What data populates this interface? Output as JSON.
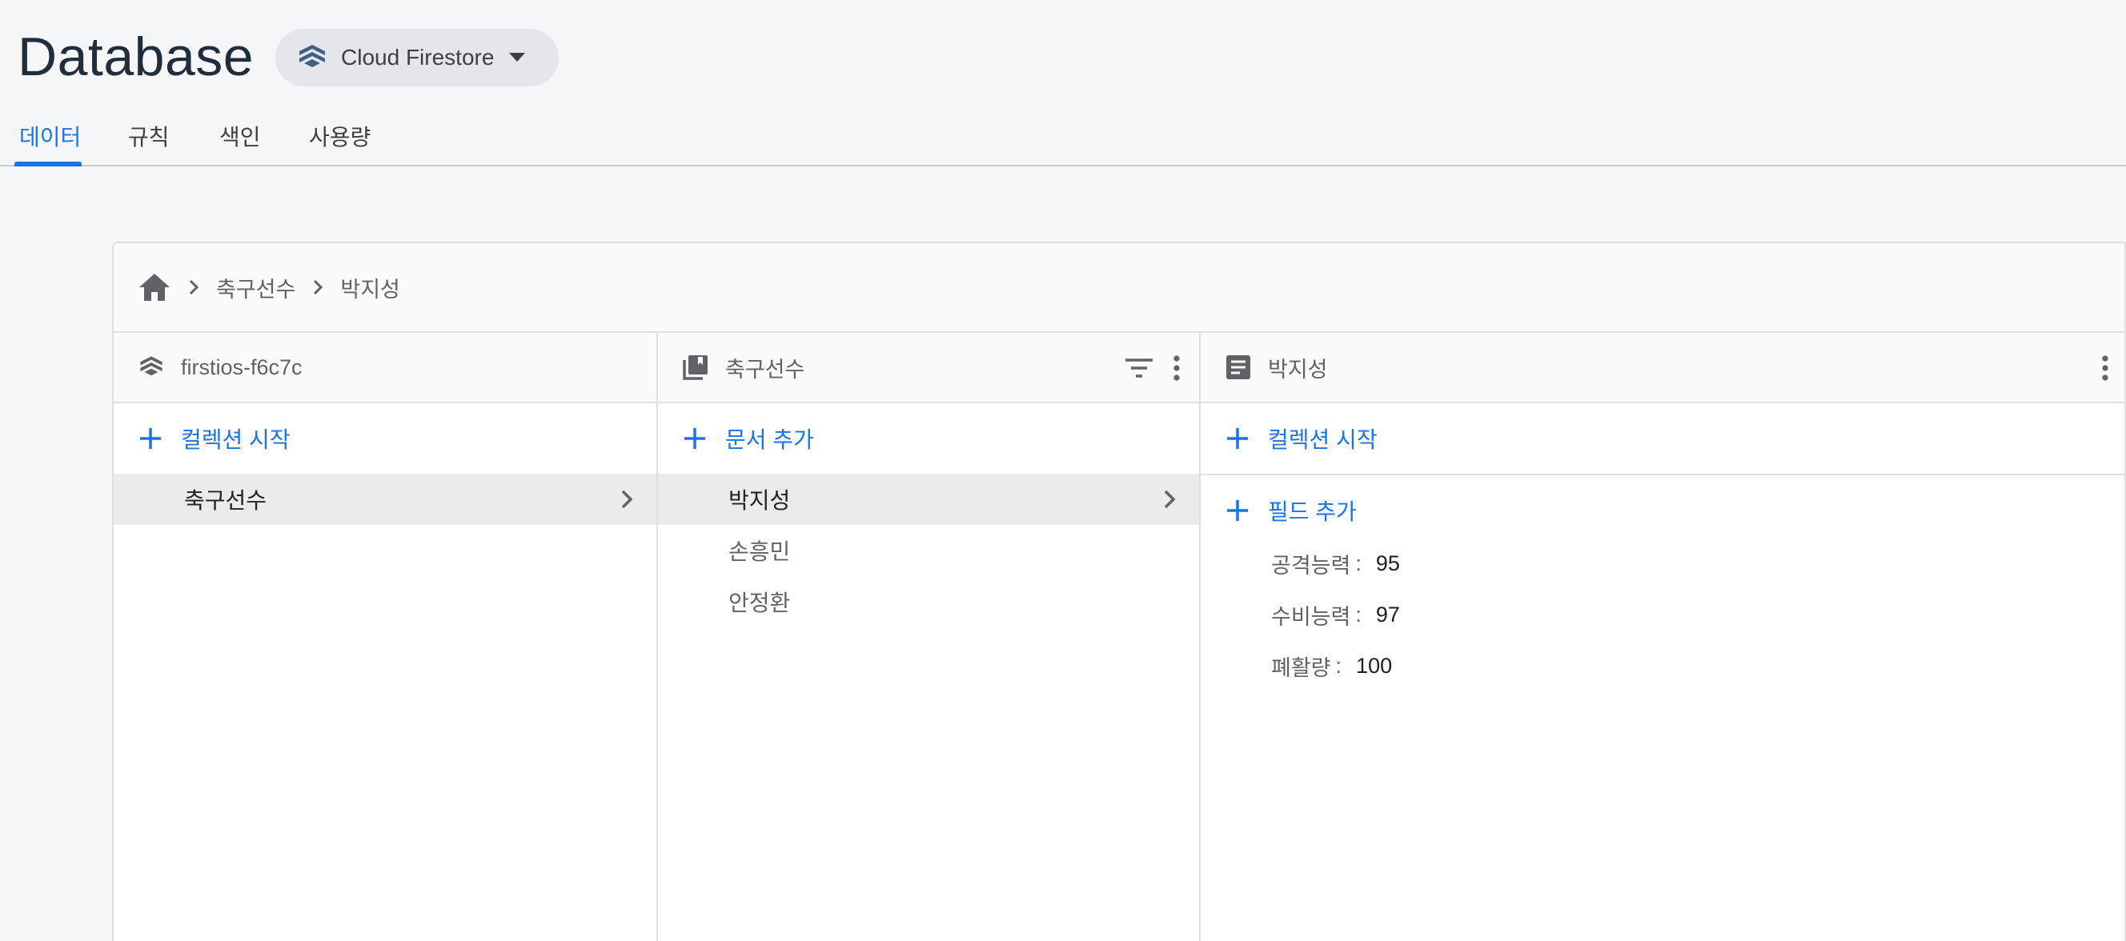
{
  "header": {
    "title": "Database",
    "product_selector": {
      "label": "Cloud Firestore",
      "icon": "firestore-icon"
    }
  },
  "tabs": [
    {
      "label": "데이터",
      "active": true
    },
    {
      "label": "규칙",
      "active": false
    },
    {
      "label": "색인",
      "active": false
    },
    {
      "label": "사용량",
      "active": false
    }
  ],
  "breadcrumb": {
    "home_icon": "home-icon",
    "items": [
      "축구선수",
      "박지성"
    ]
  },
  "columns": {
    "root": {
      "title": "firstios-f6c7c",
      "add_label": "컬렉션 시작",
      "items": [
        {
          "label": "축구선수",
          "selected": true
        }
      ]
    },
    "collection": {
      "title": "축구선수",
      "add_label": "문서 추가",
      "items": [
        {
          "label": "박지성",
          "selected": true
        },
        {
          "label": "손흥민",
          "selected": false
        },
        {
          "label": "안정환",
          "selected": false
        }
      ]
    },
    "document": {
      "title": "박지성",
      "add_collection_label": "컬렉션 시작",
      "add_field_label": "필드 추가",
      "fields": [
        {
          "key": "공격능력",
          "value": "95"
        },
        {
          "key": "수비능력",
          "value": "97"
        },
        {
          "key": "폐활량",
          "value": "100"
        }
      ]
    }
  },
  "colors": {
    "accent": "#1a73e8",
    "title": "#1f2d3d",
    "selected_row": "#ebebeb",
    "background": "#f5f6f8"
  }
}
